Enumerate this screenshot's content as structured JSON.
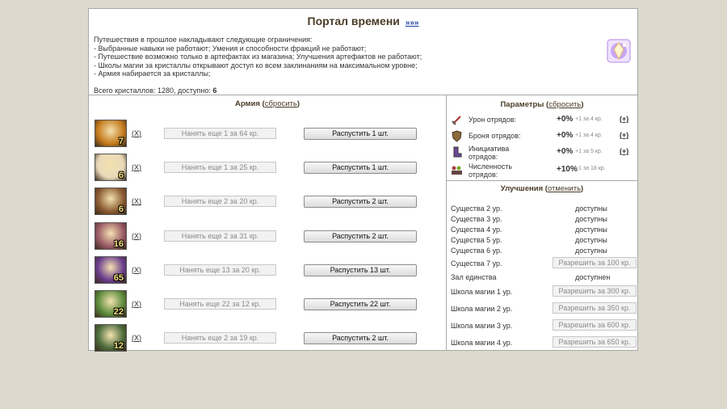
{
  "header": {
    "title": "Портал времени",
    "more_link": "»»»",
    "description": [
      "Путешествия в прошлое накладывают следующие ограничения:",
      "- Выбранные навыки не работают; Умения и способности фракций не работают;",
      "- Путешествие возможно только в артефактах из магазина; Улучшения артефактов не работают;",
      "- Школы магии за кристаллы открывают доступ ко всем заклинаниям на максимальном уровне;",
      "- Армия набирается за кристаллы;"
    ],
    "crystals_text": "Всего кристаллов: 1280, доступно:",
    "crystals_available": "6",
    "icon": "crystal-icon"
  },
  "army": {
    "title": "Армия",
    "reset_link": "сбросить",
    "remove_label": "X",
    "rows": [
      {
        "count": "7",
        "hire": "Нанять еще 1 за 64 кр.",
        "dismiss": "Распустить 1 шт.",
        "bg": "#c47a1c"
      },
      {
        "count": "6",
        "hire": "Нанять еще 1 за 25 кр.",
        "dismiss": "Распустить 1 шт.",
        "bg": "#e8d8b8"
      },
      {
        "count": "6",
        "hire": "Нанять еще 2 за 20 кр.",
        "dismiss": "Распустить 2 шт.",
        "bg": "#8a5a32"
      },
      {
        "count": "16",
        "hire": "Нанять еще 2 за 31 кр.",
        "dismiss": "Распустить 2 шт.",
        "bg": "#9a5a66"
      },
      {
        "count": "65",
        "hire": "Нанять еще 13 за 20 кр.",
        "dismiss": "Распустить 13 шт.",
        "bg": "#6a3c8c"
      },
      {
        "count": "22",
        "hire": "Нанять еще 22 за 12 кр.",
        "dismiss": "Распустить 22 шт.",
        "bg": "#5a8a3a"
      },
      {
        "count": "12",
        "hire": "Нанять еще 2 за 19 кр.",
        "dismiss": "Распустить 2 шт.",
        "bg": "#4a6a3a"
      }
    ]
  },
  "params": {
    "title": "Параметры",
    "reset_link": "сбросить",
    "plus_label": "(+)",
    "rows": [
      {
        "label": "Урон отрядов:",
        "value": "+0%",
        "cost": "+1 за 4 кр.",
        "icon": "sword-icon"
      },
      {
        "label": "Броня отрядов:",
        "value": "+0%",
        "cost": "+1 за 4 кр.",
        "icon": "shield-icon"
      },
      {
        "label": "Инициатива отрядов:",
        "value": "+0%",
        "cost": "+1 за 5 кр.",
        "icon": "boot-icon"
      },
      {
        "label": "Численность отрядов:",
        "value": "+10%",
        "cost": "+1 за 18 кр.",
        "icon": "group-icon"
      }
    ]
  },
  "upgrades": {
    "title": "Улучшения",
    "cancel_link": "отменить",
    "rows": [
      {
        "label": "Существа 2 ур.",
        "status": "доступны"
      },
      {
        "label": "Существа 3 ур.",
        "status": "доступны"
      },
      {
        "label": "Существа 4 ур.",
        "status": "доступны"
      },
      {
        "label": "Существа 5 ур.",
        "status": "доступны"
      },
      {
        "label": "Существа 6 ур.",
        "status": "доступны"
      },
      {
        "label": "Существа 7 ур.",
        "button": "Разрешить за 100 кр."
      },
      {
        "label": "Зал единства",
        "status": "доступнен"
      },
      {
        "label": "Школа магии 1 ур.",
        "button": "Разрешить за 300 кр."
      },
      {
        "label": "Школа магии 2 ур.",
        "button": "Разрешить за 350 кр."
      },
      {
        "label": "Школа магии 3 ур.",
        "button": "Разрешить за 600 кр."
      },
      {
        "label": "Школа магии 4 ур.",
        "button": "Разрешить за 650 кр."
      }
    ]
  }
}
